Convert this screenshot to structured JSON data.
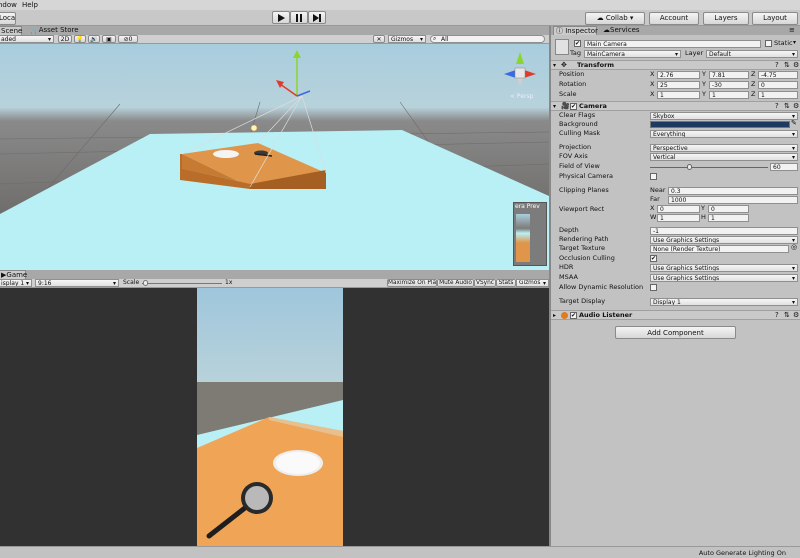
{
  "menu": {
    "items": [
      "ndow",
      "Help"
    ]
  },
  "toolbar": {
    "local": "Local",
    "collab": "Collab ▾",
    "account": "Account",
    "layers": "Layers",
    "layout": "Layout"
  },
  "scene": {
    "tabs": [
      "Scene",
      "Asset Store"
    ],
    "shading": "aded",
    "mode_2d": "2D",
    "fx_count": "0",
    "gizmos": "Gizmos",
    "search_placeholder": "All",
    "persp_label": "< Persp",
    "camera_preview": "era Prev"
  },
  "game": {
    "tab": "Game",
    "display": "isplay 1",
    "aspect": "9:16",
    "scale_label": "Scale",
    "scale_value": "1x",
    "toggles": [
      "Maximize On Play",
      "Mute Audio",
      "VSync",
      "Stats",
      "Gizmos"
    ]
  },
  "inspector": {
    "tabs": [
      "Inspector",
      "Services"
    ],
    "object_name": "Main Camera",
    "static_label": "Static",
    "tag_label": "Tag",
    "tag_value": "MainCamera",
    "layer_label": "Layer",
    "layer_value": "Default",
    "transform": {
      "title": "Transform",
      "position": {
        "label": "Position",
        "x": "2.76",
        "y": "7.81",
        "z": "-4.75"
      },
      "rotation": {
        "label": "Rotation",
        "x": "25",
        "y": "-30",
        "z": "0"
      },
      "scale": {
        "label": "Scale",
        "x": "1",
        "y": "1",
        "z": "1"
      }
    },
    "camera": {
      "title": "Camera",
      "clear_flags": {
        "label": "Clear Flags",
        "value": "Skybox"
      },
      "background": {
        "label": "Background",
        "color": "#1f3a60"
      },
      "culling_mask": {
        "label": "Culling Mask",
        "value": "Everything"
      },
      "projection": {
        "label": "Projection",
        "value": "Perspective"
      },
      "fov_axis": {
        "label": "FOV Axis",
        "value": "Vertical"
      },
      "fov": {
        "label": "Field of View",
        "value": "60",
        "fraction": 0.33
      },
      "physical": {
        "label": "Physical Camera"
      },
      "clipping": {
        "label": "Clipping Planes",
        "near_label": "Near",
        "near": "0.3",
        "far_label": "Far",
        "far": "1000"
      },
      "viewport": {
        "label": "Viewport Rect",
        "x": "0",
        "y": "0",
        "w": "1",
        "h": "1"
      },
      "depth": {
        "label": "Depth",
        "value": "-1"
      },
      "rendering_path": {
        "label": "Rendering Path",
        "value": "Use Graphics Settings"
      },
      "target_texture": {
        "label": "Target Texture",
        "value": "None (Render Texture)"
      },
      "occlusion": {
        "label": "Occlusion Culling"
      },
      "hdr": {
        "label": "HDR",
        "value": "Use Graphics Settings"
      },
      "msaa": {
        "label": "MSAA",
        "value": "Use Graphics Settings"
      },
      "dynamic_res": {
        "label": "Allow Dynamic Resolution"
      },
      "target_display": {
        "label": "Target Display",
        "value": "Display 1"
      }
    },
    "audio_listener": {
      "title": "Audio Listener"
    },
    "add_component": "Add Component"
  },
  "statusbar": {
    "text": "Auto Generate Lighting On"
  },
  "colors": {
    "sky": "#a9cdde",
    "floor": "#b8f0f6",
    "table": "#e0964a",
    "gizmo_x": "#e23a2a",
    "gizmo_y": "#8ad62a",
    "gizmo_z": "#3a6ae2"
  }
}
